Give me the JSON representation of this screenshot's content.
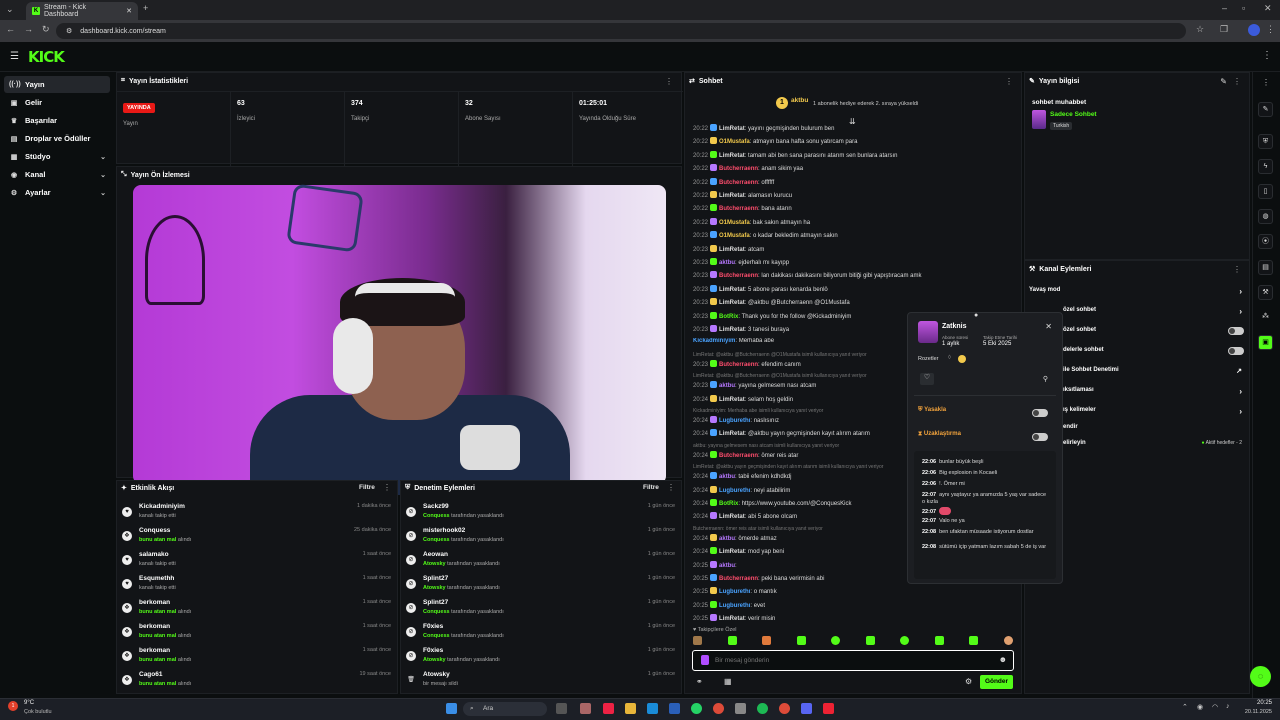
{
  "browser": {
    "tab_title": "Stream - Kick Dashboard",
    "url": "dashboard.kick.com/stream"
  },
  "brand": {
    "logo": "KICK",
    "accent": "#53fc18",
    "live_color": "#e91916"
  },
  "sidebar": {
    "items": [
      {
        "label": "Yayın",
        "icon": "broadcast-icon",
        "active": true
      },
      {
        "label": "Gelir",
        "icon": "wallet-icon"
      },
      {
        "label": "Başarılar",
        "icon": "trophy-icon"
      },
      {
        "label": "Droplar ve Ödüller",
        "icon": "gift-icon"
      },
      {
        "label": "Stüdyo",
        "icon": "studio-icon",
        "expandable": true
      },
      {
        "label": "Kanal",
        "icon": "channel-icon",
        "expandable": true
      },
      {
        "label": "Ayarlar",
        "icon": "gear-icon",
        "expandable": true
      }
    ]
  },
  "stats": {
    "title": "Yayın İstatistikleri",
    "items": [
      {
        "value": "YAYINDA",
        "label": "Yayın"
      },
      {
        "value": "63",
        "label": "İzleyici"
      },
      {
        "value": "374",
        "label": "Takipçi"
      },
      {
        "value": "32",
        "label": "Abone Sayısı"
      },
      {
        "value": "01:25:01",
        "label": "Yayında Olduğu Süre"
      }
    ]
  },
  "preview": {
    "title": "Yayın Ön İzlemesi"
  },
  "activity": {
    "title": "Etkinlik Akışı",
    "filter": "Filtre",
    "rows": [
      {
        "name": "Kickadminiyim",
        "sub_pre": "",
        "sub": "kanalı takip etti",
        "time": "1 dakika önce"
      },
      {
        "name": "Conquess",
        "sub_pre": "bunu atan mal",
        "sub": "alındı",
        "time": "25 dakika önce"
      },
      {
        "name": "salamako",
        "sub_pre": "",
        "sub": "kanalı takip etti",
        "time": "1 saat önce"
      },
      {
        "name": "Esqumethh",
        "sub_pre": "",
        "sub": "kanalı takip etti",
        "time": "1 saat önce"
      },
      {
        "name": "berkoman",
        "sub_pre": "bunu atan mal",
        "sub": "alındı",
        "time": "1 saat önce"
      },
      {
        "name": "berkoman",
        "sub_pre": "bunu atan mal",
        "sub": "alındı",
        "time": "1 saat önce"
      },
      {
        "name": "berkoman",
        "sub_pre": "bunu atan mal",
        "sub": "alındı",
        "time": "1 saat önce"
      },
      {
        "name": "Cago61",
        "sub_pre": "bunu atan mal",
        "sub": "alındı",
        "time": "19 saat önce"
      }
    ]
  },
  "moderation": {
    "title": "Denetim Eylemleri",
    "filter": "Filtre",
    "rows": [
      {
        "name": "Sackz99",
        "sub_pre": "Conquess",
        "sub": "tarafından yasaklandı",
        "time": "1 gün önce"
      },
      {
        "name": "misterhook02",
        "sub_pre": "Conquess",
        "sub": "tarafından yasaklandı",
        "time": "1 gün önce"
      },
      {
        "name": "Aeowan",
        "sub_pre": "Atowsky",
        "sub": "tarafından yasaklandı",
        "time": "1 gün önce"
      },
      {
        "name": "Splint27",
        "sub_pre": "Atowsky",
        "sub": "tarafından yasaklandı",
        "time": "1 gün önce"
      },
      {
        "name": "Splint27",
        "sub_pre": "Conquess",
        "sub": "tarafından yasaklandı",
        "time": "1 gün önce"
      },
      {
        "name": "F0xies",
        "sub_pre": "Conquess",
        "sub": "tarafından yasaklandı",
        "time": "1 gün önce"
      },
      {
        "name": "F0xies",
        "sub_pre": "Atowsky",
        "sub": "tarafından yasaklandı",
        "time": "1 gün önce"
      },
      {
        "name": "Atowsky",
        "sub_pre": "",
        "sub": "bir mesajı sildi",
        "time": "1 gün önce"
      }
    ]
  },
  "chat": {
    "title": "Sohbet",
    "pinned_user": "aktbu",
    "pinned_text": "1 abonelik hediye ederek 2. sıraya yükseldi",
    "messages": [
      {
        "time": "20:22",
        "user": "LimRetat",
        "color": "#ddd",
        "text": "yayını geçmişinden bulurum ben",
        "type": "msg"
      },
      {
        "time": "20:22",
        "user": "O1Mustafa",
        "color": "#f2c94c",
        "text": "atmayın bana hafta sonu yatırcam para",
        "type": "msg"
      },
      {
        "time": "20:22",
        "user": "LimRetat",
        "color": "#ddd",
        "text": "tamam abi ben sana parasını atarım sen bunlara atarsın",
        "type": "msg"
      },
      {
        "time": "20:22",
        "user": "Butcherraenn",
        "color": "#ff4d6d",
        "text": "anam sikim yaa",
        "type": "msg"
      },
      {
        "time": "20:22",
        "user": "Butcherraenn",
        "color": "#ff4d6d",
        "text": "offffff",
        "type": "msg"
      },
      {
        "time": "20:22",
        "user": "LimRetat",
        "color": "#ddd",
        "text": "alamasın kurucu",
        "type": "msg"
      },
      {
        "time": "20:22",
        "user": "Butcherraenn",
        "color": "#ff4d6d",
        "text": "bana atarın",
        "type": "msg"
      },
      {
        "time": "20:22",
        "user": "O1Mustafa",
        "color": "#f2c94c",
        "text": "bak sakın atmayın ha",
        "type": "msg"
      },
      {
        "time": "20:23",
        "user": "O1Mustafa",
        "color": "#f2c94c",
        "text": "o kadar bekledim atmayın sakın",
        "type": "msg"
      },
      {
        "time": "20:23",
        "user": "LimRetat",
        "color": "#ddd",
        "text": "atcam",
        "type": "msg"
      },
      {
        "time": "20:23",
        "user": "aktbu",
        "color": "#b678ff",
        "text": "ejderhalı mı kayıpp",
        "type": "msg"
      },
      {
        "time": "20:23",
        "user": "Butcherraenn",
        "color": "#ff4d6d",
        "text": "lan dakikası dakikasını biliyorum bitiği gibi yapıştıracam amk",
        "type": "msg"
      },
      {
        "time": "20:23",
        "user": "LimRetat",
        "color": "#ddd",
        "text": "5 abone parası kenarda benlö",
        "type": "msg"
      },
      {
        "time": "20:23",
        "user": "LimRetat",
        "color": "#ddd",
        "text": "@aktbu @Butcherraenn @O1Mustafa",
        "type": "msg"
      },
      {
        "time": "20:23",
        "user": "BotRix",
        "color": "#53fc18",
        "text": "Thank you for the follow @Kickadminiyim",
        "type": "msg"
      },
      {
        "time": "20:23",
        "user": "LimRetat",
        "color": "#ddd",
        "text": "3 tanesi buraya",
        "type": "msg"
      },
      {
        "time": "",
        "user": "Kickadminiyim",
        "color": "#4aa3ff",
        "text": "Merhaba abe",
        "type": "plain"
      },
      {
        "time": "",
        "user": "",
        "color": "",
        "text": "LimRetat: @aktbu @Butcherraenn @O1Mustafa isimli kullanıcıya yanıt veriyor",
        "type": "ref"
      },
      {
        "time": "20:23",
        "user": "Butcherraenn",
        "color": "#ff4d6d",
        "text": "efendim canım",
        "type": "msg"
      },
      {
        "time": "",
        "user": "",
        "color": "",
        "text": "LimRetat: @aktbu @Butcherraenn @O1Mustafa isimli kullanıcıya yanıt veriyor",
        "type": "ref"
      },
      {
        "time": "20:23",
        "user": "aktbu",
        "color": "#b678ff",
        "text": "yayına gelmesem nası atcam",
        "type": "msg"
      },
      {
        "time": "20:24",
        "user": "LimRetat",
        "color": "#ddd",
        "text": "selam hoş geldin",
        "type": "msg"
      },
      {
        "time": "",
        "user": "",
        "color": "",
        "text": "Kickadminiyim: Merhaba abe isimli kullanıcıya yanıt veriyor",
        "type": "ref"
      },
      {
        "time": "20:24",
        "user": "Lugburethı",
        "color": "#4aa3ff",
        "text": "naslısınız",
        "type": "msg"
      },
      {
        "time": "20:24",
        "user": "LimRetat",
        "color": "#ddd",
        "text": "@aktbu yayın geçmişinden kayıt alırım atarım",
        "type": "msg"
      },
      {
        "time": "",
        "user": "",
        "color": "",
        "text": "aktbu: yayına gelmesem nası atcam isimli kullanıcıya yanıt veriyor",
        "type": "ref"
      },
      {
        "time": "20:24",
        "user": "Butcherraenn",
        "color": "#ff4d6d",
        "text": "ömer reis atar",
        "type": "msg"
      },
      {
        "time": "",
        "user": "",
        "color": "",
        "text": "LimRetat: @aktbu yayın geçmişinden kayıt alırım atarım isimli kullanıcıya yanıt veriyor",
        "type": "ref"
      },
      {
        "time": "20:24",
        "user": "aktbu",
        "color": "#b678ff",
        "text": "tabii efenim kdhdkdj",
        "type": "msg"
      },
      {
        "time": "20:24",
        "user": "Lugburethı",
        "color": "#4aa3ff",
        "text": "neyi atabilirim",
        "type": "msg"
      },
      {
        "time": "20:24",
        "user": "BotRix",
        "color": "#53fc18",
        "text": "https://www.youtube.com/@ConquesKick",
        "type": "msg"
      },
      {
        "time": "20:24",
        "user": "LimRetat",
        "color": "#ddd",
        "text": "abi 5 abone olcam",
        "type": "msg"
      },
      {
        "time": "",
        "user": "",
        "color": "",
        "text": "Butcherraenn: ömer reis atar isimli kullanıcıya yanıt veriyor",
        "type": "ref"
      },
      {
        "time": "20:24",
        "user": "aktbu",
        "color": "#b678ff",
        "text": "ömerde atmaz",
        "type": "msg"
      },
      {
        "time": "20:24",
        "user": "LimRetat",
        "color": "#ddd",
        "text": "mod yap beni",
        "type": "msg"
      },
      {
        "time": "20:25",
        "user": "aktbu",
        "color": "#b678ff",
        "text": "",
        "type": "msg"
      },
      {
        "time": "20:25",
        "user": "Butcherraenn",
        "color": "#ff4d6d",
        "text": "peki bana verirmisin abi",
        "type": "msg"
      },
      {
        "time": "20:25",
        "user": "Lugburethı",
        "color": "#4aa3ff",
        "text": "o mantık",
        "type": "msg"
      },
      {
        "time": "20:25",
        "user": "Lugburethı",
        "color": "#4aa3ff",
        "text": "evet",
        "type": "msg"
      },
      {
        "time": "20:25",
        "user": "LimRetat",
        "color": "#ddd",
        "text": "verir misin",
        "type": "msg"
      }
    ],
    "followers_only": "Takipçilere Özel",
    "input_placeholder": "Bir mesaj gönderin",
    "send_label": "Gönder"
  },
  "user_card": {
    "username": "Zatknis",
    "sub_label": "Abone süresi",
    "sub_value": "1 aylık",
    "follow_label": "Takip Etme Tarihi",
    "follow_value": "5 Eki 2025",
    "badges_label": "Rozetler",
    "ban_label": "Yasakla",
    "timeout_label": "Uzaklaştırma",
    "history": [
      {
        "time": "22:06",
        "text": "bunlar büyük beşli"
      },
      {
        "time": "22:06",
        "text": "Big explosion in Kocaeli"
      },
      {
        "time": "22:06",
        "text": "!. Ömer mi"
      },
      {
        "time": "22:07",
        "text": "aynı yaştayız ya aramızda 5 yaş var sadece o kızla"
      },
      {
        "time": "22:07",
        "text": ""
      },
      {
        "time": "22:07",
        "text": "Valo ne ya"
      },
      {
        "time": "22:08",
        "text": "ben ufaktan müsaade istiyorum dostlar"
      },
      {
        "time": "22:08",
        "text": "sütümü içip yatmam lazım sabah 5 de iş var"
      }
    ]
  },
  "stream_info": {
    "title": "Yayın bilgisi",
    "stream_title": "sohbet muhabbet",
    "category": "Sadece Sohbet",
    "language": "Turkish"
  },
  "channel_actions": {
    "title": "Kanal Eylemleri",
    "rows": [
      {
        "label": "Yavaş mod",
        "control": "chevron"
      },
      {
        "label": "özel sohbet",
        "control": "chevron"
      },
      {
        "label": "özel sohbet",
        "control": "toggle"
      },
      {
        "label": "delerle sohbet",
        "control": "toggle"
      },
      {
        "label": "ile Sohbet Denetimi",
        "control": "external"
      },
      {
        "label": "ıksıtlaması",
        "control": "chevron"
      },
      {
        "label": "ış kelimeler",
        "control": "chevron"
      },
      {
        "label": "endir",
        "control": "none"
      },
      {
        "label": "elirleyin",
        "control": "goal"
      }
    ],
    "goal_text": "Aktif hedefler - 2"
  },
  "taskbar": {
    "weather_temp": "9°C",
    "weather_text": "Çok bulutlu",
    "search": "Ara",
    "time": "20:25",
    "date": "20.11.2025",
    "notif_count": "1"
  }
}
